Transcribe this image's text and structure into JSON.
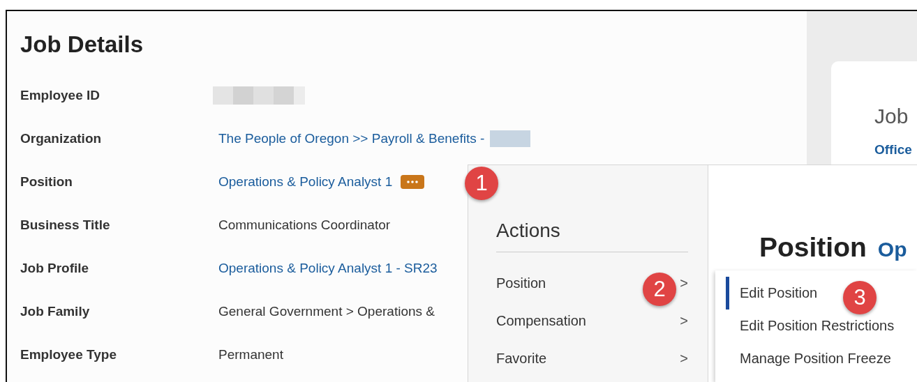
{
  "job_details": {
    "title": "Job Details",
    "fields": [
      {
        "label": "Employee ID",
        "kind": "text",
        "redacted": true,
        "related_actions": false
      },
      {
        "label": "Organization",
        "value": "The People of Oregon >> Payroll & Benefits -",
        "kind": "link",
        "redacted": true,
        "related_actions": false
      },
      {
        "label": "Position",
        "value": "Operations & Policy Analyst 1",
        "kind": "link",
        "redacted": false,
        "related_actions": true
      },
      {
        "label": "Business Title",
        "value": "Communications Coordinator",
        "kind": "text",
        "redacted": false,
        "related_actions": false
      },
      {
        "label": "Job Profile",
        "value": "Operations & Policy Analyst 1 - SR23",
        "kind": "link",
        "redacted": false,
        "related_actions": false
      },
      {
        "label": "Job Family",
        "value": "General Government > Operations &",
        "kind": "text",
        "redacted": false,
        "related_actions": false
      },
      {
        "label": "Employee Type",
        "value": "Permanent",
        "kind": "text",
        "redacted": false,
        "related_actions": false
      }
    ]
  },
  "side_card": {
    "title": "Job",
    "link": "Office"
  },
  "actions_menu": {
    "title": "Actions",
    "items": [
      {
        "label": "Position",
        "chevron": ">"
      },
      {
        "label": "Compensation",
        "chevron": ">"
      },
      {
        "label": "Favorite",
        "chevron": ">"
      }
    ],
    "preview": {
      "title": "Position",
      "link": "Op"
    },
    "submenu": [
      {
        "label": "Edit Position",
        "selected": true
      },
      {
        "label": "Edit Position Restrictions",
        "selected": false
      },
      {
        "label": "Manage Position Freeze",
        "selected": false
      }
    ]
  },
  "callouts": [
    {
      "label": "1"
    },
    {
      "label": "2"
    },
    {
      "label": "3"
    }
  ]
}
